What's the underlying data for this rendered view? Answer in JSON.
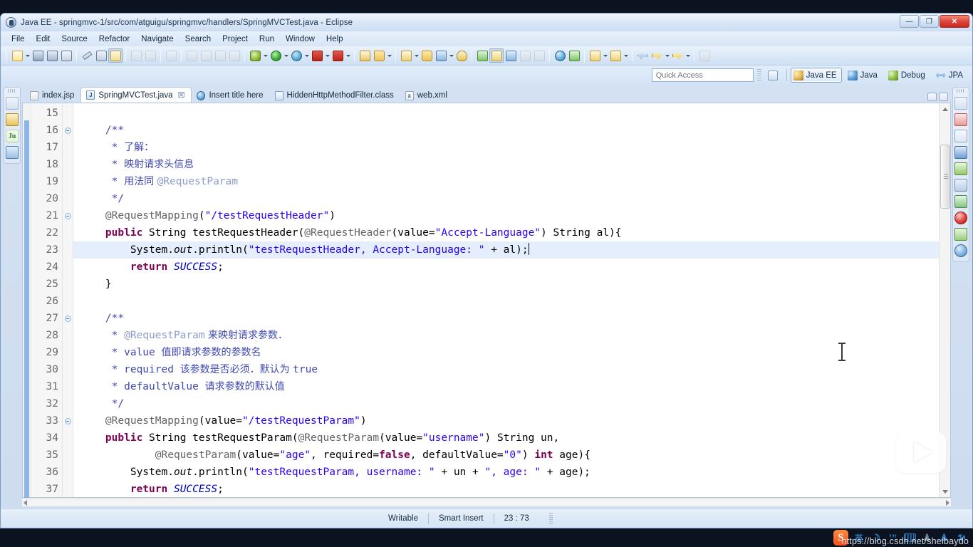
{
  "window": {
    "title": "Java EE - springmvc-1/src/com/atguigu/springmvc/handlers/SpringMVCTest.java - Eclipse",
    "minimize_label": "—",
    "maximize_label": "❐",
    "close_label": "✕"
  },
  "menu": {
    "items": [
      "File",
      "Edit",
      "Source",
      "Refactor",
      "Navigate",
      "Search",
      "Project",
      "Run",
      "Window",
      "Help"
    ]
  },
  "toolbar": {
    "groups": [
      {
        "buttons": [
          {
            "name": "new-wizard",
            "glyph": "g-new",
            "arrow": true
          },
          {
            "name": "save",
            "glyph": "g-save",
            "arrow": false
          },
          {
            "name": "save-all",
            "glyph": "g-saveall",
            "arrow": false
          },
          {
            "name": "print",
            "glyph": "g-print",
            "arrow": false
          }
        ]
      },
      {
        "buttons": [
          {
            "name": "quick-fix",
            "glyph": "g-pen",
            "arrow": false
          },
          {
            "name": "toggle-breadcrumb",
            "glyph": "g-list",
            "arrow": false
          },
          {
            "name": "open-type",
            "glyph": "g-class",
            "arrow": false,
            "pressed": true
          }
        ]
      },
      {
        "buttons": [
          {
            "name": "undo-disabled",
            "glyph": "g-gray",
            "arrow": false
          },
          {
            "name": "redo-disabled",
            "glyph": "g-gray",
            "arrow": false
          }
        ]
      },
      {
        "buttons": [
          {
            "name": "back-disabled",
            "glyph": "g-gray",
            "arrow": false
          }
        ]
      },
      {
        "buttons": [
          {
            "name": "resume-disabled",
            "glyph": "g-gray",
            "arrow": false
          },
          {
            "name": "suspend-disabled",
            "glyph": "g-gray",
            "arrow": false
          },
          {
            "name": "terminate-disabled",
            "glyph": "g-gray",
            "arrow": false
          },
          {
            "name": "disconnect-disabled",
            "glyph": "g-gray",
            "arrow": false
          }
        ]
      },
      {
        "buttons": [
          {
            "name": "debug",
            "glyph": "g-debug",
            "arrow": true
          },
          {
            "name": "run",
            "glyph": "g-run",
            "arrow": true
          },
          {
            "name": "run-external-tools",
            "glyph": "g-dbg2",
            "arrow": true
          },
          {
            "name": "stop-server",
            "glyph": "g-stop",
            "arrow": true
          },
          {
            "name": "start-server",
            "glyph": "g-stop2",
            "arrow": true
          }
        ]
      },
      {
        "buttons": [
          {
            "name": "new-java-project",
            "glyph": "g-ext",
            "arrow": false
          },
          {
            "name": "new-package",
            "glyph": "g-folder",
            "arrow": true
          }
        ]
      },
      {
        "buttons": [
          {
            "name": "new-class",
            "glyph": "g-yel",
            "arrow": true
          },
          {
            "name": "open-task",
            "glyph": "g-folder",
            "arrow": false
          },
          {
            "name": "open-resource",
            "glyph": "g-blue",
            "arrow": true
          },
          {
            "name": "search",
            "glyph": "g-srch",
            "arrow": false
          }
        ]
      },
      {
        "buttons": [
          {
            "name": "link-editor",
            "glyph": "g-grn",
            "arrow": false
          },
          {
            "name": "annotation-toggle",
            "glyph": "g-yel",
            "arrow": false,
            "pressed": true
          },
          {
            "name": "skip-breakpoints",
            "glyph": "g-blue",
            "arrow": false
          },
          {
            "name": "show-whitespace",
            "glyph": "g-gray",
            "arrow": false
          },
          {
            "name": "block-selection",
            "glyph": "g-gray",
            "arrow": false
          }
        ]
      },
      {
        "buttons": [
          {
            "name": "open-browser",
            "glyph": "g-web",
            "arrow": false
          },
          {
            "name": "new-connection",
            "glyph": "g-grn",
            "arrow": false
          }
        ]
      },
      {
        "buttons": [
          {
            "name": "next-annotation",
            "glyph": "g-yel",
            "arrow": true
          },
          {
            "name": "previous-annotation",
            "glyph": "g-yel",
            "arrow": true
          }
        ]
      },
      {
        "buttons": [
          {
            "name": "back-history",
            "glyph": "g-arrow-b",
            "arrow": false
          },
          {
            "name": "forward-history",
            "glyph": "g-arrow-y",
            "arrow": true
          },
          {
            "name": "last-edit-location",
            "glyph": "g-arrow-y",
            "arrow": true
          }
        ]
      },
      {
        "buttons": [
          {
            "name": "pin-editor",
            "glyph": "g-gray",
            "arrow": false
          }
        ]
      }
    ]
  },
  "quick_access": {
    "placeholder": "Quick Access",
    "value": ""
  },
  "perspectives": {
    "open_perspective_label": "",
    "items": [
      {
        "label": "Java EE",
        "icon": "p-javaee",
        "active": true
      },
      {
        "label": "Java",
        "icon": "p-java",
        "active": false
      },
      {
        "label": "Debug",
        "icon": "p-debug",
        "active": false
      },
      {
        "label": "JPA",
        "icon": "p-jpa",
        "active": false
      }
    ]
  },
  "left_strip": {
    "icons": [
      {
        "name": "restore-view",
        "cls": "si-restore",
        "text": ""
      },
      {
        "name": "package-explorer",
        "cls": "si-pkg",
        "text": ""
      },
      {
        "name": "junit-view",
        "cls": "si-junit",
        "text": "Ju"
      },
      {
        "name": "outline-view",
        "cls": "si-outline",
        "text": ""
      }
    ]
  },
  "right_strip": {
    "icons": [
      {
        "name": "restore-view",
        "cls": "si-restore",
        "text": ""
      },
      {
        "name": "servers-view",
        "cls": "si-srv",
        "text": ""
      },
      {
        "name": "console-view",
        "cls": "si-win",
        "text": ""
      },
      {
        "name": "display-view",
        "cls": "si-mon",
        "text": ""
      },
      {
        "name": "plugins-view",
        "cls": "si-plug",
        "text": ""
      },
      {
        "name": "snippets-view",
        "cls": "si-snip",
        "text": ""
      },
      {
        "name": "tasks-view",
        "cls": "si-task",
        "text": ""
      },
      {
        "name": "problems-view",
        "cls": "si-prob",
        "text": ""
      },
      {
        "name": "servers-list-view",
        "cls": "si-srvs",
        "text": ""
      },
      {
        "name": "internal-browser-view",
        "cls": "si-globe",
        "text": ""
      }
    ]
  },
  "editor_tabs": {
    "items": [
      {
        "label": "index.jsp",
        "icon": "ti-jsp",
        "icon_text": "",
        "active": false,
        "dirty": false
      },
      {
        "label": "SpringMVCTest.java",
        "icon": "ti-java",
        "icon_text": "J",
        "active": true,
        "dirty": true
      },
      {
        "label": "Insert title here",
        "icon": "ti-html",
        "icon_text": "",
        "active": false,
        "dirty": false
      },
      {
        "label": "HiddenHttpMethodFilter.class",
        "icon": "ti-cls",
        "icon_text": "",
        "active": false,
        "dirty": false
      },
      {
        "label": "web.xml",
        "icon": "ti-xml",
        "icon_text": "x",
        "active": false,
        "dirty": false
      }
    ],
    "close_glyph": "☒"
  },
  "code": {
    "first_line": 15,
    "lines": [
      {
        "n": 15,
        "fold": false,
        "hl": false,
        "tokens": []
      },
      {
        "n": 16,
        "fold": true,
        "hl": false,
        "tokens": [
          {
            "t": "    /**",
            "c": "c-cmt"
          }
        ]
      },
      {
        "n": 17,
        "fold": false,
        "hl": false,
        "tokens": [
          {
            "t": "     * ",
            "c": "c-cmt"
          },
          {
            "t": "了解：",
            "c": "c-cmtz"
          }
        ]
      },
      {
        "n": 18,
        "fold": false,
        "hl": false,
        "tokens": [
          {
            "t": "     * ",
            "c": "c-cmt"
          },
          {
            "t": "映射请求头信息",
            "c": "c-cmtz"
          }
        ]
      },
      {
        "n": 19,
        "fold": false,
        "hl": false,
        "tokens": [
          {
            "t": "     * ",
            "c": "c-cmt"
          },
          {
            "t": "用法同 ",
            "c": "c-cmtz"
          },
          {
            "t": "@RequestParam",
            "c": "c-cmtt"
          }
        ]
      },
      {
        "n": 20,
        "fold": false,
        "hl": false,
        "tokens": [
          {
            "t": "     */",
            "c": "c-cmt"
          }
        ]
      },
      {
        "n": 21,
        "fold": true,
        "hl": false,
        "tokens": [
          {
            "t": "    ",
            "c": ""
          },
          {
            "t": "@RequestMapping",
            "c": "c-ann"
          },
          {
            "t": "(",
            "c": ""
          },
          {
            "t": "\"/testRequestHeader\"",
            "c": "c-str"
          },
          {
            "t": ")",
            "c": ""
          }
        ]
      },
      {
        "n": 22,
        "fold": false,
        "hl": false,
        "tokens": [
          {
            "t": "    ",
            "c": ""
          },
          {
            "t": "public",
            "c": "c-kw"
          },
          {
            "t": " String testRequestHeader(",
            "c": ""
          },
          {
            "t": "@RequestHeader",
            "c": "c-ann"
          },
          {
            "t": "(value=",
            "c": ""
          },
          {
            "t": "\"Accept-Language\"",
            "c": "c-str"
          },
          {
            "t": ") String al){",
            "c": ""
          }
        ]
      },
      {
        "n": 23,
        "fold": false,
        "hl": true,
        "tokens": [
          {
            "t": "        System.",
            "c": ""
          },
          {
            "t": "out",
            "c": "c-static"
          },
          {
            "t": ".println(",
            "c": ""
          },
          {
            "t": "\"testRequestHeader, Accept-Language: \"",
            "c": "c-str"
          },
          {
            "t": " + al);",
            "c": ""
          }
        ],
        "caret": true
      },
      {
        "n": 24,
        "fold": false,
        "hl": false,
        "tokens": [
          {
            "t": "        ",
            "c": ""
          },
          {
            "t": "return",
            "c": "c-kw"
          },
          {
            "t": " ",
            "c": ""
          },
          {
            "t": "SUCCESS",
            "c": "c-field"
          },
          {
            "t": ";",
            "c": ""
          }
        ]
      },
      {
        "n": 25,
        "fold": false,
        "hl": false,
        "tokens": [
          {
            "t": "    }",
            "c": ""
          }
        ]
      },
      {
        "n": 26,
        "fold": false,
        "hl": false,
        "tokens": []
      },
      {
        "n": 27,
        "fold": true,
        "hl": false,
        "tokens": [
          {
            "t": "    /**",
            "c": "c-cmt"
          }
        ]
      },
      {
        "n": 28,
        "fold": false,
        "hl": false,
        "tokens": [
          {
            "t": "     * ",
            "c": "c-cmt"
          },
          {
            "t": "@RequestParam",
            "c": "c-cmtt"
          },
          {
            "t": " 来映射请求参数．",
            "c": "c-cmtz"
          }
        ]
      },
      {
        "n": 29,
        "fold": false,
        "hl": false,
        "tokens": [
          {
            "t": "     * value ",
            "c": "c-cmt"
          },
          {
            "t": "值即请求参数的参数名",
            "c": "c-cmtz"
          }
        ]
      },
      {
        "n": 30,
        "fold": false,
        "hl": false,
        "tokens": [
          {
            "t": "     * required ",
            "c": "c-cmt"
          },
          {
            "t": "该参数是否必须．默认为 ",
            "c": "c-cmtz"
          },
          {
            "t": "true",
            "c": "c-cmt"
          }
        ]
      },
      {
        "n": 31,
        "fold": false,
        "hl": false,
        "tokens": [
          {
            "t": "     * defaultValue ",
            "c": "c-cmt"
          },
          {
            "t": "请求参数的默认值",
            "c": "c-cmtz"
          }
        ]
      },
      {
        "n": 32,
        "fold": false,
        "hl": false,
        "tokens": [
          {
            "t": "     */",
            "c": "c-cmt"
          }
        ]
      },
      {
        "n": 33,
        "fold": true,
        "hl": false,
        "tokens": [
          {
            "t": "    ",
            "c": ""
          },
          {
            "t": "@RequestMapping",
            "c": "c-ann"
          },
          {
            "t": "(value=",
            "c": ""
          },
          {
            "t": "\"/testRequestParam\"",
            "c": "c-str"
          },
          {
            "t": ")",
            "c": ""
          }
        ]
      },
      {
        "n": 34,
        "fold": false,
        "hl": false,
        "tokens": [
          {
            "t": "    ",
            "c": ""
          },
          {
            "t": "public",
            "c": "c-kw"
          },
          {
            "t": " String testRequestParam(",
            "c": ""
          },
          {
            "t": "@RequestParam",
            "c": "c-ann"
          },
          {
            "t": "(value=",
            "c": ""
          },
          {
            "t": "\"username\"",
            "c": "c-str"
          },
          {
            "t": ") String un,",
            "c": ""
          }
        ]
      },
      {
        "n": 35,
        "fold": false,
        "hl": false,
        "tokens": [
          {
            "t": "            ",
            "c": ""
          },
          {
            "t": "@RequestParam",
            "c": "c-ann"
          },
          {
            "t": "(value=",
            "c": ""
          },
          {
            "t": "\"age\"",
            "c": "c-str"
          },
          {
            "t": ", required=",
            "c": ""
          },
          {
            "t": "false",
            "c": "c-kw"
          },
          {
            "t": ", defaultValue=",
            "c": ""
          },
          {
            "t": "\"0\"",
            "c": "c-str"
          },
          {
            "t": ") ",
            "c": ""
          },
          {
            "t": "int",
            "c": "c-kw"
          },
          {
            "t": " age){",
            "c": ""
          }
        ]
      },
      {
        "n": 36,
        "fold": false,
        "hl": false,
        "tokens": [
          {
            "t": "        System.",
            "c": ""
          },
          {
            "t": "out",
            "c": "c-static"
          },
          {
            "t": ".println(",
            "c": ""
          },
          {
            "t": "\"testRequestParam, username: \"",
            "c": "c-str"
          },
          {
            "t": " + un + ",
            "c": ""
          },
          {
            "t": "\", age: \"",
            "c": "c-str"
          },
          {
            "t": " + age);",
            "c": ""
          }
        ]
      },
      {
        "n": 37,
        "fold": false,
        "hl": false,
        "tokens": [
          {
            "t": "        ",
            "c": ""
          },
          {
            "t": "return",
            "c": "c-kw"
          },
          {
            "t": " ",
            "c": ""
          },
          {
            "t": "SUCCESS",
            "c": "c-field"
          },
          {
            "t": ";",
            "c": ""
          }
        ]
      }
    ]
  },
  "statusbar": {
    "writable": "Writable",
    "insert_mode": "Smart Insert",
    "position": "23 : 73"
  },
  "tray": {
    "sogou_logo": "S",
    "language_mode": "英",
    "icons": [
      {
        "name": "moon-icon",
        "glyph": "☽",
        "cls": "t-moon"
      },
      {
        "name": "punctuation-icon",
        "glyph": "’”",
        "cls": "t-moon"
      },
      {
        "name": "soft-keyboard-icon",
        "glyph": "",
        "cls": "t-kbd"
      },
      {
        "name": "user-icon",
        "glyph": "♟",
        "cls": "t-per"
      },
      {
        "name": "skin-icon",
        "glyph": "♟",
        "cls": "t-shirt"
      },
      {
        "name": "toolbox-icon",
        "glyph": "⚒",
        "cls": "t-wr"
      }
    ]
  },
  "watermark": "https://blog.csdn.net/sheibaydo"
}
